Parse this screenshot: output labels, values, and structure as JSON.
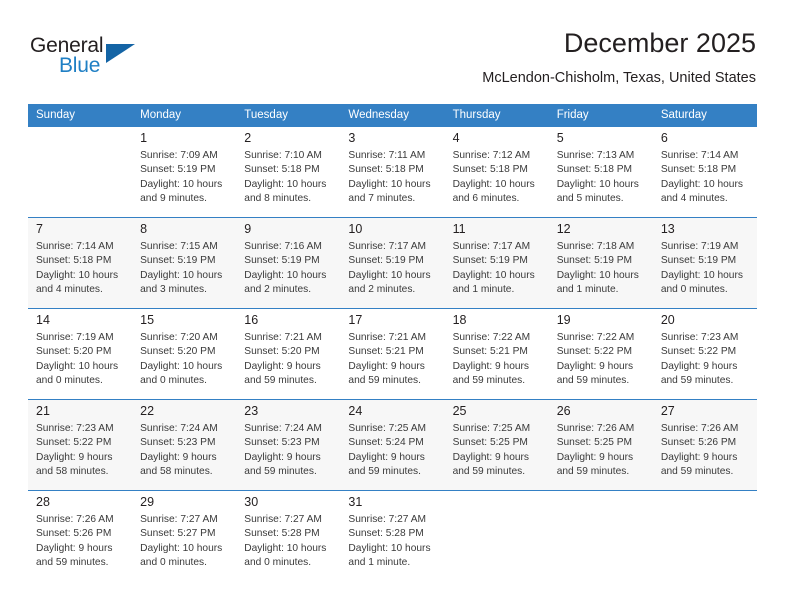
{
  "brand": {
    "name_part1": "General",
    "name_part2": "Blue",
    "triangle_color": "#1464a5",
    "blue_color": "#1f7fc4"
  },
  "header": {
    "title": "December 2025",
    "subtitle": "McLendon-Chisholm, Texas, United States"
  },
  "theme": {
    "header_bg": "#3480c4",
    "header_text": "#ffffff",
    "alt_row_bg": "#f7f7f7",
    "text": "#231f20"
  },
  "weekdays": [
    "Sunday",
    "Monday",
    "Tuesday",
    "Wednesday",
    "Thursday",
    "Friday",
    "Saturday"
  ],
  "weeks": [
    [
      {
        "day": "",
        "sunrise": "",
        "sunset": "",
        "daylight": ""
      },
      {
        "day": "1",
        "sunrise": "Sunrise: 7:09 AM",
        "sunset": "Sunset: 5:19 PM",
        "daylight": "Daylight: 10 hours and 9 minutes."
      },
      {
        "day": "2",
        "sunrise": "Sunrise: 7:10 AM",
        "sunset": "Sunset: 5:18 PM",
        "daylight": "Daylight: 10 hours and 8 minutes."
      },
      {
        "day": "3",
        "sunrise": "Sunrise: 7:11 AM",
        "sunset": "Sunset: 5:18 PM",
        "daylight": "Daylight: 10 hours and 7 minutes."
      },
      {
        "day": "4",
        "sunrise": "Sunrise: 7:12 AM",
        "sunset": "Sunset: 5:18 PM",
        "daylight": "Daylight: 10 hours and 6 minutes."
      },
      {
        "day": "5",
        "sunrise": "Sunrise: 7:13 AM",
        "sunset": "Sunset: 5:18 PM",
        "daylight": "Daylight: 10 hours and 5 minutes."
      },
      {
        "day": "6",
        "sunrise": "Sunrise: 7:14 AM",
        "sunset": "Sunset: 5:18 PM",
        "daylight": "Daylight: 10 hours and 4 minutes."
      }
    ],
    [
      {
        "day": "7",
        "sunrise": "Sunrise: 7:14 AM",
        "sunset": "Sunset: 5:18 PM",
        "daylight": "Daylight: 10 hours and 4 minutes."
      },
      {
        "day": "8",
        "sunrise": "Sunrise: 7:15 AM",
        "sunset": "Sunset: 5:19 PM",
        "daylight": "Daylight: 10 hours and 3 minutes."
      },
      {
        "day": "9",
        "sunrise": "Sunrise: 7:16 AM",
        "sunset": "Sunset: 5:19 PM",
        "daylight": "Daylight: 10 hours and 2 minutes."
      },
      {
        "day": "10",
        "sunrise": "Sunrise: 7:17 AM",
        "sunset": "Sunset: 5:19 PM",
        "daylight": "Daylight: 10 hours and 2 minutes."
      },
      {
        "day": "11",
        "sunrise": "Sunrise: 7:17 AM",
        "sunset": "Sunset: 5:19 PM",
        "daylight": "Daylight: 10 hours and 1 minute."
      },
      {
        "day": "12",
        "sunrise": "Sunrise: 7:18 AM",
        "sunset": "Sunset: 5:19 PM",
        "daylight": "Daylight: 10 hours and 1 minute."
      },
      {
        "day": "13",
        "sunrise": "Sunrise: 7:19 AM",
        "sunset": "Sunset: 5:19 PM",
        "daylight": "Daylight: 10 hours and 0 minutes."
      }
    ],
    [
      {
        "day": "14",
        "sunrise": "Sunrise: 7:19 AM",
        "sunset": "Sunset: 5:20 PM",
        "daylight": "Daylight: 10 hours and 0 minutes."
      },
      {
        "day": "15",
        "sunrise": "Sunrise: 7:20 AM",
        "sunset": "Sunset: 5:20 PM",
        "daylight": "Daylight: 10 hours and 0 minutes."
      },
      {
        "day": "16",
        "sunrise": "Sunrise: 7:21 AM",
        "sunset": "Sunset: 5:20 PM",
        "daylight": "Daylight: 9 hours and 59 minutes."
      },
      {
        "day": "17",
        "sunrise": "Sunrise: 7:21 AM",
        "sunset": "Sunset: 5:21 PM",
        "daylight": "Daylight: 9 hours and 59 minutes."
      },
      {
        "day": "18",
        "sunrise": "Sunrise: 7:22 AM",
        "sunset": "Sunset: 5:21 PM",
        "daylight": "Daylight: 9 hours and 59 minutes."
      },
      {
        "day": "19",
        "sunrise": "Sunrise: 7:22 AM",
        "sunset": "Sunset: 5:22 PM",
        "daylight": "Daylight: 9 hours and 59 minutes."
      },
      {
        "day": "20",
        "sunrise": "Sunrise: 7:23 AM",
        "sunset": "Sunset: 5:22 PM",
        "daylight": "Daylight: 9 hours and 59 minutes."
      }
    ],
    [
      {
        "day": "21",
        "sunrise": "Sunrise: 7:23 AM",
        "sunset": "Sunset: 5:22 PM",
        "daylight": "Daylight: 9 hours and 58 minutes."
      },
      {
        "day": "22",
        "sunrise": "Sunrise: 7:24 AM",
        "sunset": "Sunset: 5:23 PM",
        "daylight": "Daylight: 9 hours and 58 minutes."
      },
      {
        "day": "23",
        "sunrise": "Sunrise: 7:24 AM",
        "sunset": "Sunset: 5:23 PM",
        "daylight": "Daylight: 9 hours and 59 minutes."
      },
      {
        "day": "24",
        "sunrise": "Sunrise: 7:25 AM",
        "sunset": "Sunset: 5:24 PM",
        "daylight": "Daylight: 9 hours and 59 minutes."
      },
      {
        "day": "25",
        "sunrise": "Sunrise: 7:25 AM",
        "sunset": "Sunset: 5:25 PM",
        "daylight": "Daylight: 9 hours and 59 minutes."
      },
      {
        "day": "26",
        "sunrise": "Sunrise: 7:26 AM",
        "sunset": "Sunset: 5:25 PM",
        "daylight": "Daylight: 9 hours and 59 minutes."
      },
      {
        "day": "27",
        "sunrise": "Sunrise: 7:26 AM",
        "sunset": "Sunset: 5:26 PM",
        "daylight": "Daylight: 9 hours and 59 minutes."
      }
    ],
    [
      {
        "day": "28",
        "sunrise": "Sunrise: 7:26 AM",
        "sunset": "Sunset: 5:26 PM",
        "daylight": "Daylight: 9 hours and 59 minutes."
      },
      {
        "day": "29",
        "sunrise": "Sunrise: 7:27 AM",
        "sunset": "Sunset: 5:27 PM",
        "daylight": "Daylight: 10 hours and 0 minutes."
      },
      {
        "day": "30",
        "sunrise": "Sunrise: 7:27 AM",
        "sunset": "Sunset: 5:28 PM",
        "daylight": "Daylight: 10 hours and 0 minutes."
      },
      {
        "day": "31",
        "sunrise": "Sunrise: 7:27 AM",
        "sunset": "Sunset: 5:28 PM",
        "daylight": "Daylight: 10 hours and 1 minute."
      },
      {
        "day": "",
        "sunrise": "",
        "sunset": "",
        "daylight": ""
      },
      {
        "day": "",
        "sunrise": "",
        "sunset": "",
        "daylight": ""
      },
      {
        "day": "",
        "sunrise": "",
        "sunset": "",
        "daylight": ""
      }
    ]
  ]
}
